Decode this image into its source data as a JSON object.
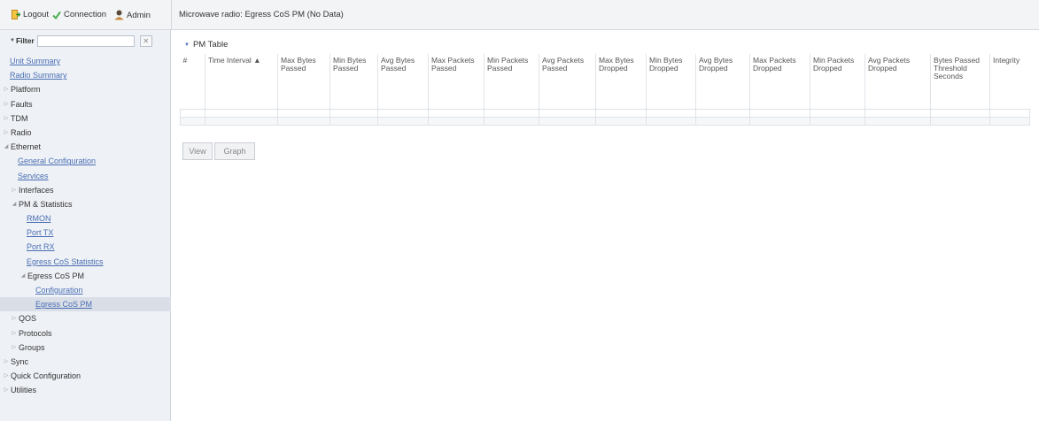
{
  "topbar": {
    "logout_label": "Logout",
    "connection_label": "Connection",
    "admin_label": "Admin",
    "page_title": "Microwave radio: Egress CoS PM (No Data)"
  },
  "sidebar": {
    "filter_label": "Filter",
    "filter_value": "",
    "filter_clear": "✕",
    "items": [
      {
        "label": "Unit Summary"
      },
      {
        "label": "Radio Summary"
      },
      {
        "label": "Platform"
      },
      {
        "label": "Faults"
      },
      {
        "label": "TDM"
      },
      {
        "label": "Radio"
      },
      {
        "label": "Ethernet"
      },
      {
        "label": "General Configuration"
      },
      {
        "label": "Services"
      },
      {
        "label": "Interfaces"
      },
      {
        "label": "PM & Statistics"
      },
      {
        "label": "RMON"
      },
      {
        "label": "Port TX"
      },
      {
        "label": "Port RX"
      },
      {
        "label": "Egress CoS Statistics"
      },
      {
        "label": "Egress CoS PM"
      },
      {
        "label": "Configuration"
      },
      {
        "label": "Egress CoS PM"
      },
      {
        "label": "QOS"
      },
      {
        "label": "Protocols"
      },
      {
        "label": "Groups"
      },
      {
        "label": "Sync"
      },
      {
        "label": "Quick Configuration"
      },
      {
        "label": "Utilities"
      }
    ]
  },
  "main": {
    "section_title": "PM Table",
    "columns": [
      "#",
      "Time Interval ▲",
      "Max Bytes Passed",
      "Min Bytes Passed",
      "Avg Bytes Passed",
      "Max Packets Passed",
      "Min Packets Passed",
      "Avg Packets Passed",
      "Max Bytes Dropped",
      "Min Bytes Dropped",
      "Avg Bytes Dropped",
      "Max Packets Dropped",
      "Min Packets Dropped",
      "Avg Packets Dropped",
      "Bytes Passed Threshold Seconds",
      "Integrity"
    ],
    "view_button": "View",
    "graph_button": "Graph"
  },
  "colors": {
    "link": "#4a6fb3",
    "sidebar_bg": "#eef1f6",
    "selected_bg": "#d9dee7",
    "connection_check": "#4caf50",
    "logout_icon": "#e0a020",
    "admin_icon": "#c98a3a"
  }
}
